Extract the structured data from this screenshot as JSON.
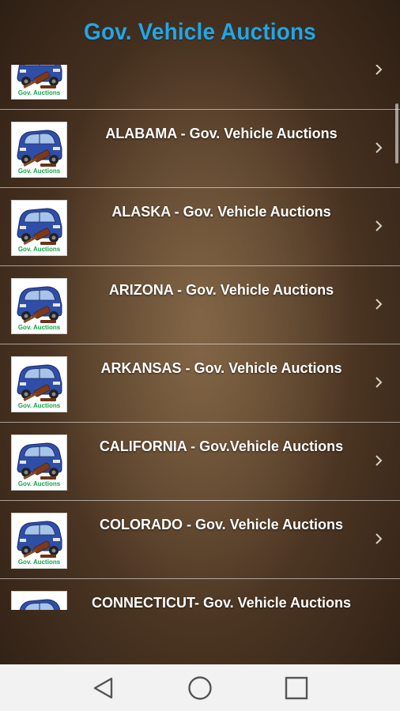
{
  "app": {
    "title": "Gov. Vehicle Auctions"
  },
  "thumbnail": {
    "caption": "Gov. Auctions",
    "icon": "car-gavel-thumbnail-icon"
  },
  "list": {
    "items": [
      {
        "label": ""
      },
      {
        "label": "ALABAMA - Gov.  Vehicle Auctions"
      },
      {
        "label": "ALASKA - Gov.  Vehicle Auctions"
      },
      {
        "label": "ARIZONA - Gov.  Vehicle Auctions"
      },
      {
        "label": "ARKANSAS - Gov.  Vehicle Auctions"
      },
      {
        "label": "CALIFORNIA - Gov.Vehicle Auctions"
      },
      {
        "label": "COLORADO - Gov.  Vehicle Auctions"
      },
      {
        "label": "CONNECTICUT- Gov. Vehicle Auctions"
      }
    ]
  },
  "navbar": {
    "back_icon": "back-triangle-icon",
    "home_icon": "home-circle-icon",
    "recents_icon": "recents-square-icon"
  },
  "colors": {
    "title": "#1fa7e8",
    "row_text": "#ffffff",
    "navbar_bg": "#f2f2f2"
  }
}
